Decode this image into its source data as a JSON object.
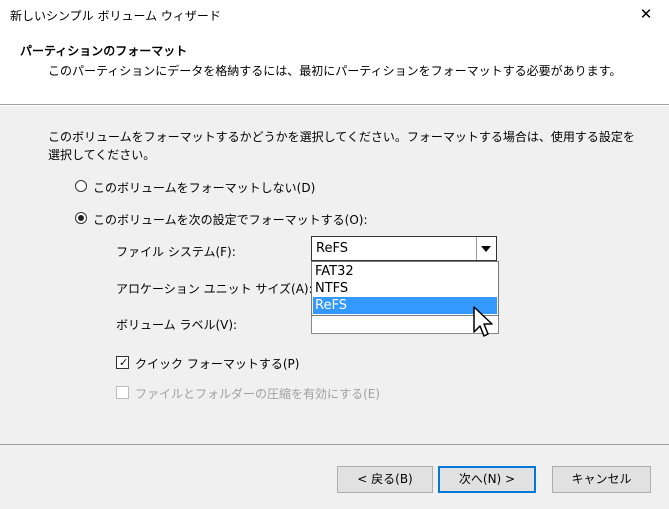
{
  "window": {
    "title": "新しいシンプル ボリューム ウィザード",
    "close_glyph": "✕"
  },
  "header": {
    "title": "パーティションのフォーマット",
    "subtitle": "このパーティションにデータを格納するには、最初にパーティションをフォーマットする必要があります。"
  },
  "main": {
    "description": "このボリュームをフォーマットするかどうかを選択してください。フォーマットする場合は、使用する設定を選択してください。",
    "radio_no_format": {
      "label": "このボリュームをフォーマットしない(D)",
      "selected": false
    },
    "radio_format": {
      "label": "このボリュームを次の設定でフォーマットする(O):",
      "selected": true
    },
    "file_system": {
      "label": "ファイル システム(F):",
      "value": "ReFS",
      "options": [
        "FAT32",
        "NTFS",
        "ReFS"
      ],
      "highlighted": "ReFS"
    },
    "allocation_unit": {
      "label": "アロケーション ユニット サイズ(A):",
      "value": ""
    },
    "volume_label": {
      "label": "ボリューム ラベル(V):",
      "value": ""
    },
    "quick_format": {
      "label": "クイック フォーマットする(P)",
      "checked": true,
      "check_glyph": "✓"
    },
    "compression": {
      "label": "ファイルとフォルダーの圧縮を有効にする(E)",
      "checked": false,
      "enabled": false
    }
  },
  "footer": {
    "back": "< 戻る(B)",
    "next": "次へ(N) >",
    "cancel": "キャンセル"
  },
  "icons": {
    "cursor": "mouse-pointer-icon",
    "dropdown": "chevron-down-icon",
    "close": "close-icon"
  },
  "colors": {
    "highlight": "#3399ff",
    "default_button_border": "#0078d7",
    "background": "#f0f0f0"
  }
}
